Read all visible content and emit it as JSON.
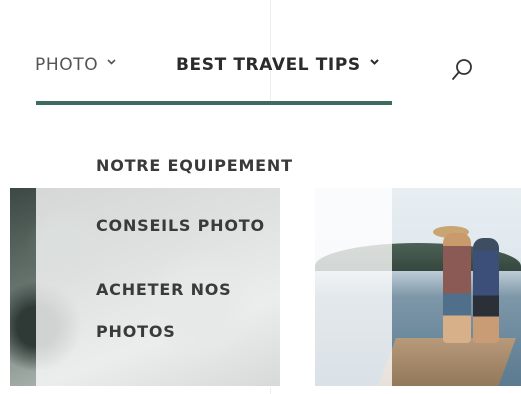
{
  "nav": {
    "items": [
      {
        "label": "PHOTO",
        "icon": "chevron-down-icon"
      },
      {
        "label": "BEST TRAVEL TIPS",
        "icon": "chevron-down-icon"
      }
    ],
    "search_icon": "search-icon",
    "underline_color": "#3e6b5f"
  },
  "dropdown": {
    "items": [
      {
        "label": "NOTRE EQUIPEMENT"
      },
      {
        "label": "CONSEILS PHOTO"
      },
      {
        "label": "ACHETER NOS PHOTOS"
      }
    ]
  }
}
